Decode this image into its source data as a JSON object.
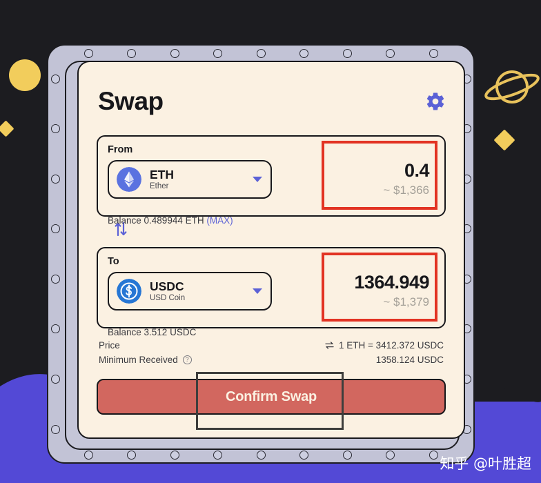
{
  "app": {
    "title": "Swap",
    "settings_icon": "gear-icon"
  },
  "from": {
    "label": "From",
    "token_symbol": "ETH",
    "token_name": "Ether",
    "token_icon": "ethereum-icon",
    "amount": "0.4",
    "amount_usd": "~ $1,366",
    "balance_text": "Balance 0.489944 ETH",
    "max_label": "(MAX)"
  },
  "swap_direction": {
    "icon": "swap-vertical-arrows-icon"
  },
  "to": {
    "label": "To",
    "token_symbol": "USDC",
    "token_name": "USD Coin",
    "token_icon": "usdc-icon",
    "amount": "1364.949",
    "amount_usd": "~ $1,379",
    "balance_text": "Balance 3.512 USDC"
  },
  "info": {
    "price_label": "Price",
    "price_value": "1 ETH = 3412.372 USDC",
    "price_swap_icon": "swap-horizontal-icon",
    "minimum_label": "Minimum Received",
    "minimum_help_icon": "question-icon",
    "minimum_help_glyph": "?",
    "minimum_value": "1358.124 USDC"
  },
  "actions": {
    "confirm_label": "Confirm Swap"
  },
  "watermark": {
    "text": "知乎 @叶胜超"
  },
  "colors": {
    "accent_blue": "#5b61d6",
    "card_bg": "#fbf1e2",
    "frame": "#c2c3d6",
    "confirm_bg": "#d2675f",
    "annotation_red": "#e23323",
    "background": "#1c1c20",
    "purple_wave": "#5349d6",
    "decor_yellow": "#f2cd5c"
  }
}
